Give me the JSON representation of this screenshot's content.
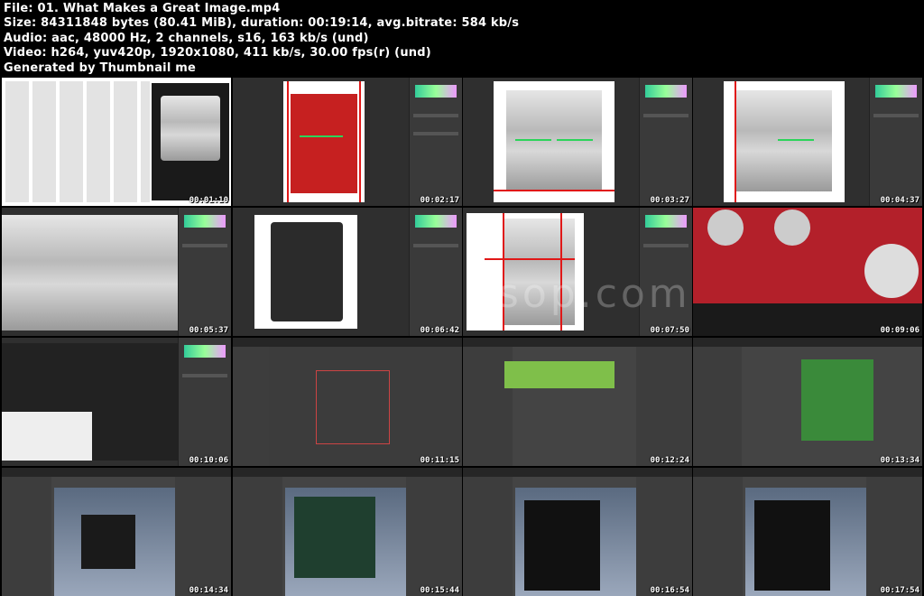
{
  "header": {
    "file": "File: 01. What Makes a Great Image.mp4",
    "size": "Size: 84311848 bytes (80.41 MiB), duration: 00:19:14, avg.bitrate: 584 kb/s",
    "audio": "Audio: aac, 48000 Hz, 2 channels, s16, 163 kb/s (und)",
    "video": "Video: h264, yuv420p, 1920x1080, 411 kb/s, 30.00 fps(r) (und)",
    "generator": "Generated by Thumbnail me"
  },
  "thumbnails": [
    {
      "time": "00:01:10"
    },
    {
      "time": "00:02:17"
    },
    {
      "time": "00:03:27"
    },
    {
      "time": "00:04:37"
    },
    {
      "time": "00:05:37"
    },
    {
      "time": "00:06:42"
    },
    {
      "time": "00:07:50"
    },
    {
      "time": "00:09:06"
    },
    {
      "time": "00:10:06"
    },
    {
      "time": "00:11:15"
    },
    {
      "time": "00:12:24"
    },
    {
      "time": "00:13:34"
    },
    {
      "time": "00:14:34"
    },
    {
      "time": "00:15:44"
    },
    {
      "time": "00:16:54"
    },
    {
      "time": "00:17:54"
    }
  ],
  "overlay": {
    "watermark": "gsop.com"
  }
}
